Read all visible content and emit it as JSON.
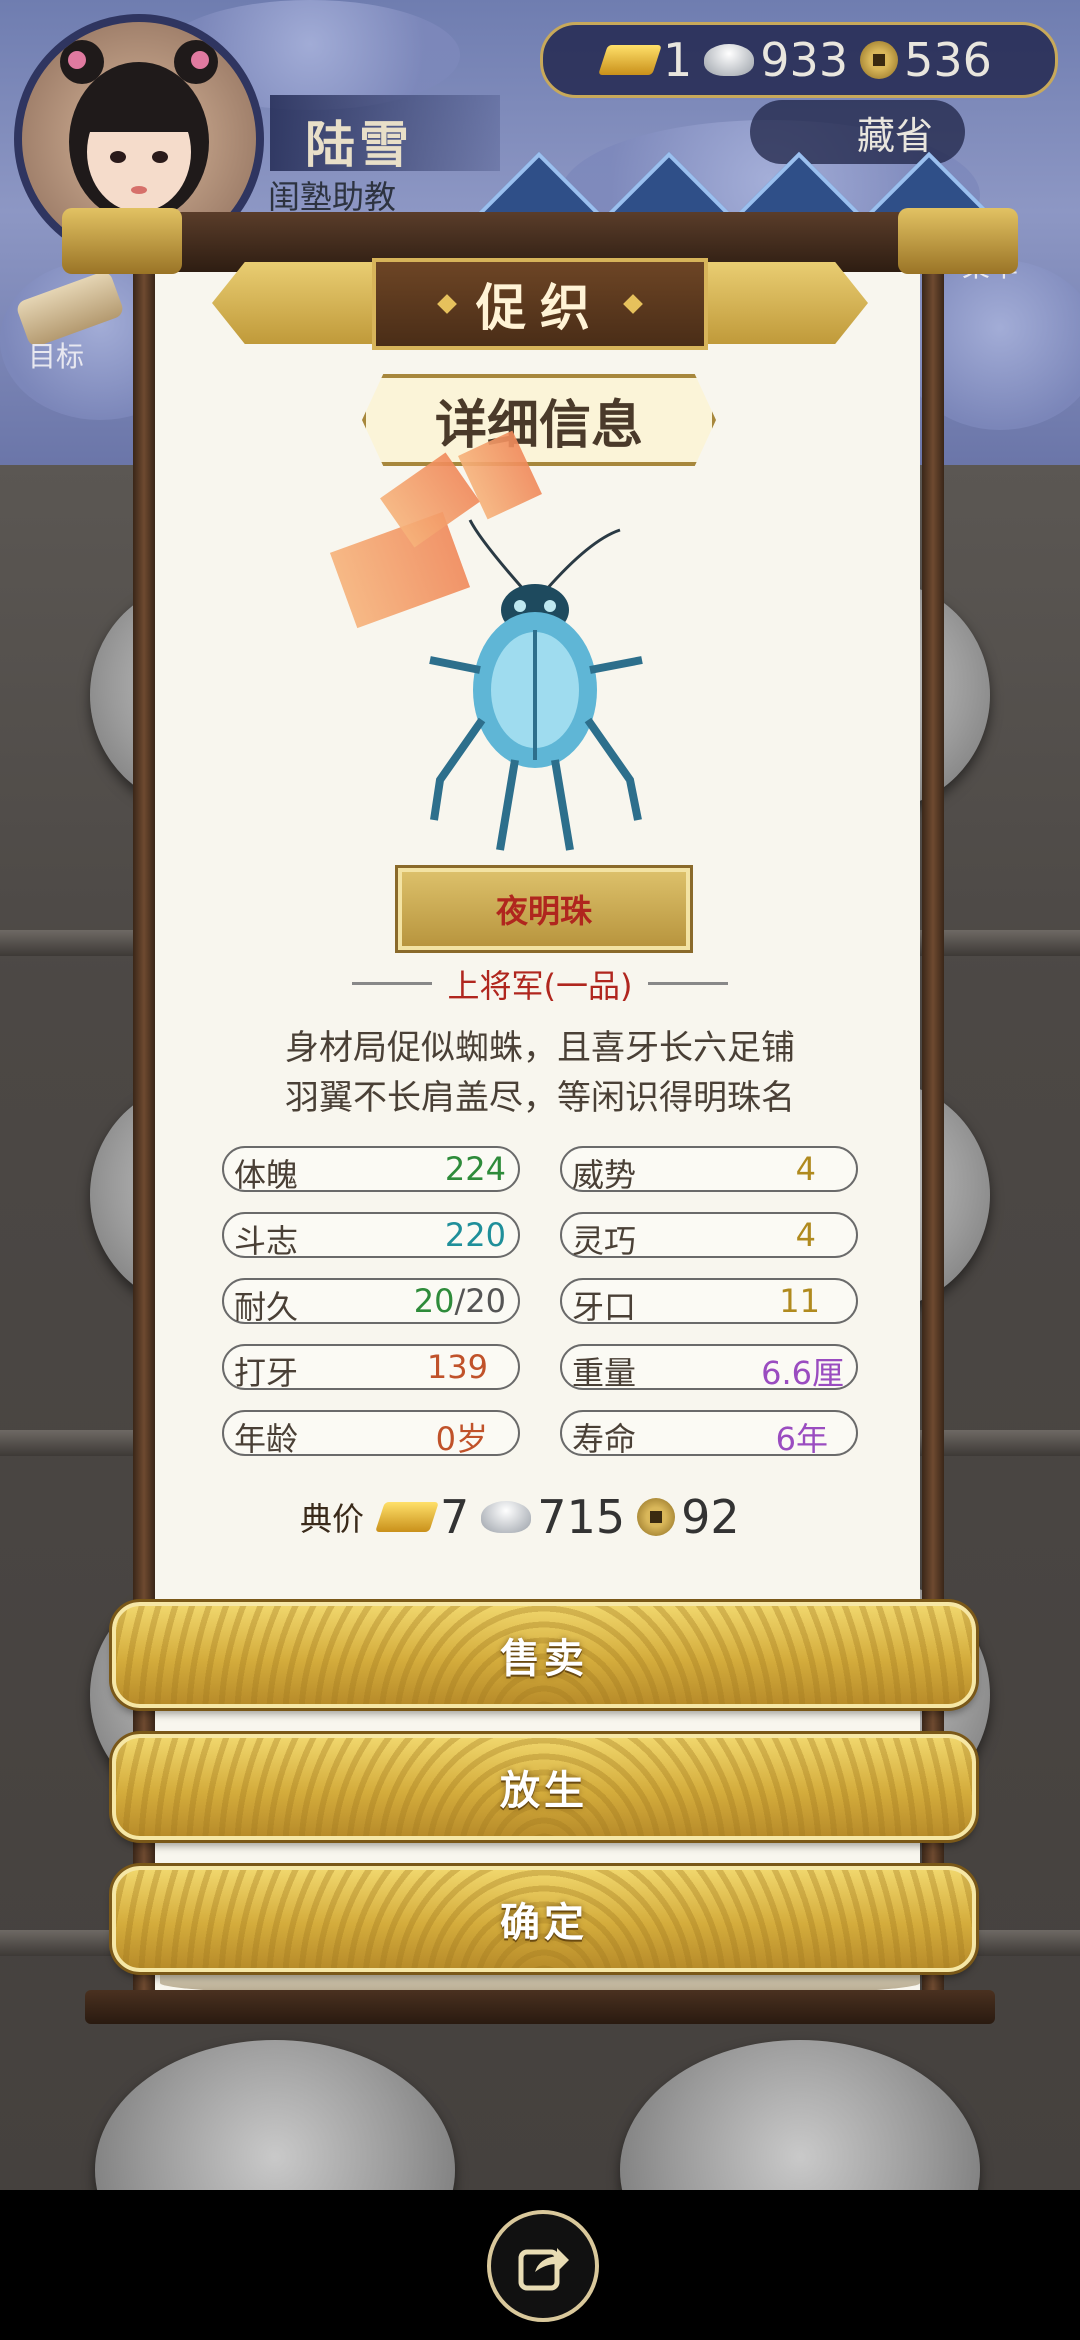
{
  "player": {
    "name": "陆雪",
    "title": "闺塾助教"
  },
  "currency": {
    "gold": "1",
    "silver": "933",
    "copper": "536"
  },
  "top_buttons": {
    "cangsheng": "藏省",
    "goal": "目标",
    "right_side": "菜单"
  },
  "dialog": {
    "header": "促织",
    "subheader": "详细信息",
    "bug_name": "夜明珠",
    "rank": "上将军(一品)",
    "desc_line1": "身材局促似蜘蛛，且喜牙长六足铺",
    "desc_line2": "羽翼不长肩盖尽，等闲识得明珠名",
    "stats": [
      {
        "label": "体魄",
        "value": "224",
        "color": "#2e8b3a"
      },
      {
        "label": "威势",
        "value": "4",
        "color": "#b08a1e"
      },
      {
        "label": "斗志",
        "value": "220",
        "color": "#1f8f9a"
      },
      {
        "label": "灵巧",
        "value": "4",
        "color": "#b08a1e"
      },
      {
        "label": "耐久",
        "value_a": "20",
        "value_b": "/20",
        "color": "#2e8b3a"
      },
      {
        "label": "牙口",
        "value": "11",
        "color": "#b08a1e"
      },
      {
        "label": "打牙",
        "value": "139",
        "color": "#c0522a"
      },
      {
        "label": "重量",
        "value": "6.6厘",
        "color": "#9a4cc0"
      },
      {
        "label": "年龄",
        "value": "0岁",
        "color": "#c0522a"
      },
      {
        "label": "寿命",
        "value": "6年",
        "color": "#9a4cc0"
      }
    ],
    "price": {
      "label": "典价",
      "gold": "7",
      "silver": "715",
      "copper": "92"
    },
    "buttons": {
      "sell": "售卖",
      "release": "放生",
      "confirm": "确定"
    }
  },
  "colors": {
    "gold_button": "#d4ac3c",
    "paper": "#f8f6ee",
    "rank_red": "#b0261e"
  }
}
